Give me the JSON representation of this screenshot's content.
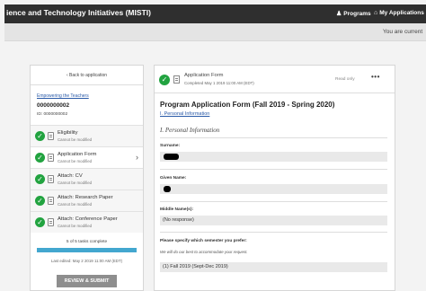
{
  "header": {
    "title": "ience and Technology Initiatives (MISTI)",
    "programs_label": "Programs",
    "my_apps_label": "My Applications"
  },
  "subheader": {
    "message": "You are current"
  },
  "sidebar": {
    "back_label": "Back to application",
    "program_name": "Empowering the Teachers",
    "app_number": "0000000002",
    "app_id": "ID: 0000000002",
    "tasks": [
      {
        "label": "Eligibility",
        "status": "Cannot be modified"
      },
      {
        "label": "Application Form",
        "status": "Cannot be modified"
      },
      {
        "label": "Attach: CV",
        "status": "Cannot be modified"
      },
      {
        "label": "Attach: Research Paper",
        "status": "Cannot be modified"
      },
      {
        "label": "Attach: Conference Paper",
        "status": "Cannot be modified"
      }
    ],
    "progress_text": "5 of 5 tasks complete",
    "progress_fraction": 1.0,
    "last_edited": "Last edited: May 2 2019 11:00 AM (EDT)",
    "review_button": "REVIEW & SUBMIT"
  },
  "form_panel": {
    "header_title": "Application Form",
    "header_sub": "Completed May 1 2019 11:00 AM (EDT)",
    "read_only": "Read only",
    "more_label": "•••",
    "form_title": "Program Application Form (Fall 2019 - Spring 2020)",
    "section_link": "I. Personal Information",
    "section_heading": "I. Personal Information",
    "surname_label": "Surname:",
    "given_name_label": "Given Name:",
    "middle_name_label": "Middle Name(s):",
    "middle_name_value": "(No response)",
    "semester_label": "Please specify which semester you prefer:",
    "semester_help": "We will do our best to accommodate your request.",
    "semester_value": "(1) Fall 2019 (Sept-Dec 2019)"
  },
  "colors": {
    "topbar": "#2f2f2f",
    "check_green": "#22a340",
    "progress_blue": "#43a7cf",
    "link_blue": "#2a5aa8"
  },
  "icons": [
    "programs-icon",
    "home-icon",
    "chevron-left-icon",
    "check-circle-icon",
    "document-icon",
    "chevron-right-icon",
    "more-icon"
  ]
}
